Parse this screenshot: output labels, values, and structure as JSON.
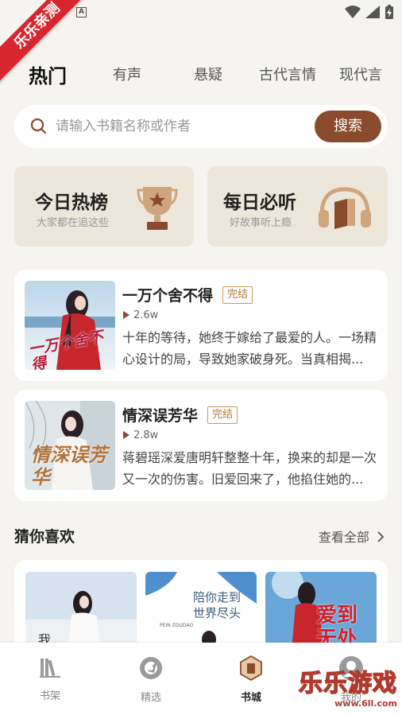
{
  "ribbon": {
    "label": "乐乐亲测"
  },
  "tabs": [
    {
      "label": "热门"
    },
    {
      "label": "有声"
    },
    {
      "label": "悬疑"
    },
    {
      "label": "古代言情"
    },
    {
      "label": "现代言"
    }
  ],
  "search": {
    "placeholder": "请输入书籍名称或作者",
    "button": "搜索"
  },
  "cards": [
    {
      "title": "今日热榜",
      "subtitle": "大家都在追这些"
    },
    {
      "title": "每日必听",
      "subtitle": "好故事听上瘾"
    }
  ],
  "books": [
    {
      "title": "一万个舍不得",
      "badge": "完结",
      "heat": "2.6w",
      "desc": "十年的等待，她终于嫁给了最爱的人。一场精心设计的局，导致她家破身死。当真相揭...",
      "cover_text": "一万个舍不得"
    },
    {
      "title": "情深误芳华",
      "badge": "完结",
      "heat": "2.8w",
      "desc": "蒋碧瑶深爱唐明轩整整十年，换来的却是一次又一次的伤害。旧爱回来了，他掐住她的...",
      "cover_text": "情深误芳华"
    }
  ],
  "guess": {
    "title": "猜你喜欢",
    "more": "查看全部",
    "covers": [
      {
        "text": "我"
      },
      {
        "text": "陪你走到世界尽头",
        "sub": "PEIN ZOUDAO"
      },
      {
        "text": "爱到无处可逃"
      }
    ]
  },
  "nav": [
    {
      "label": "书架"
    },
    {
      "label": "精选"
    },
    {
      "label": "书城"
    },
    {
      "label": "我的"
    }
  ],
  "watermark": {
    "big": "乐乐游戏",
    "small": "www.6ll.com"
  },
  "colors": {
    "accent": "#8a4a2d",
    "bg": "#f6f4f1",
    "card": "#ede6da",
    "ribbon": "#d8262e"
  }
}
